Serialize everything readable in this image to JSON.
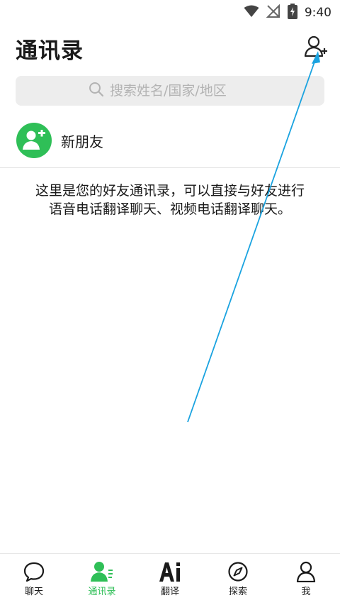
{
  "status_bar": {
    "time": "9:40",
    "icons": [
      "wifi-icon",
      "no-signal-icon",
      "battery-charging-icon"
    ]
  },
  "header": {
    "title": "通讯录",
    "add_icon": "add-contact-icon"
  },
  "search": {
    "placeholder": "搜索姓名/国家/地区",
    "value": "",
    "icon": "search-icon"
  },
  "new_friend": {
    "label": "新朋友",
    "icon": "add-person-icon"
  },
  "empty_message": "这里是您的好友通讯录，可以直接与好友进行语音电话翻译聊天、视频电话翻译聊天。",
  "tabs": [
    {
      "label": "聊天",
      "icon": "chat-bubble-icon",
      "active": false
    },
    {
      "label": "通讯录",
      "icon": "contacts-icon",
      "active": true
    },
    {
      "label": "翻译",
      "icon": "ai-icon",
      "active": false
    },
    {
      "label": "探索",
      "icon": "compass-icon",
      "active": false
    },
    {
      "label": "我",
      "icon": "profile-icon",
      "active": false
    }
  ],
  "colors": {
    "accent": "#2fbf57",
    "annotation_arrow": "#1aa3e0",
    "search_bg": "#ededed"
  }
}
